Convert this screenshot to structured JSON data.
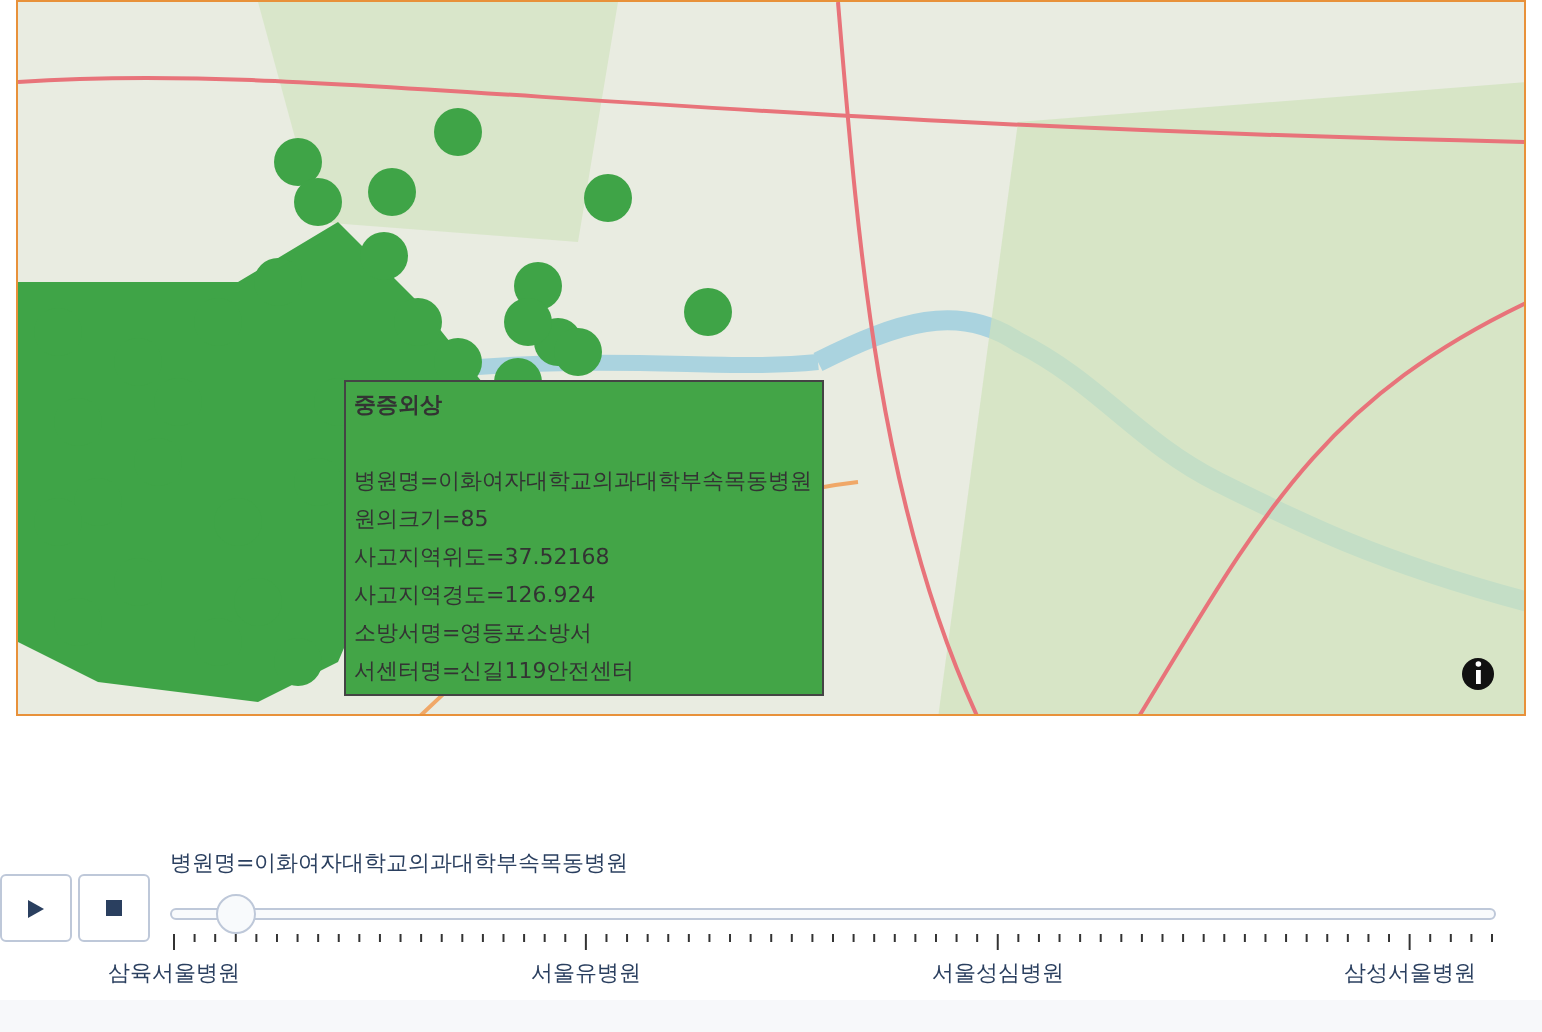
{
  "tooltip": {
    "title": "중증외상",
    "lines": [
      "병원명=이화여자대학교의과대학부속목동병원",
      "원의크기=85",
      "사고지역위도=37.52168",
      "사고지역경도=126.924",
      "소방서명=영등포소방서",
      "서센터명=신길119안전센터"
    ]
  },
  "controls": {
    "buttons": [
      {
        "kind": "play"
      },
      {
        "kind": "stop"
      }
    ]
  },
  "slider": {
    "current_label": "병원명=이화여자대학교의과대학부속목동병원",
    "level": 0.05,
    "tick_labels": [
      "삼육서울병원",
      "서울유병원",
      "서울성심병원",
      "삼성서울병원"
    ]
  }
}
